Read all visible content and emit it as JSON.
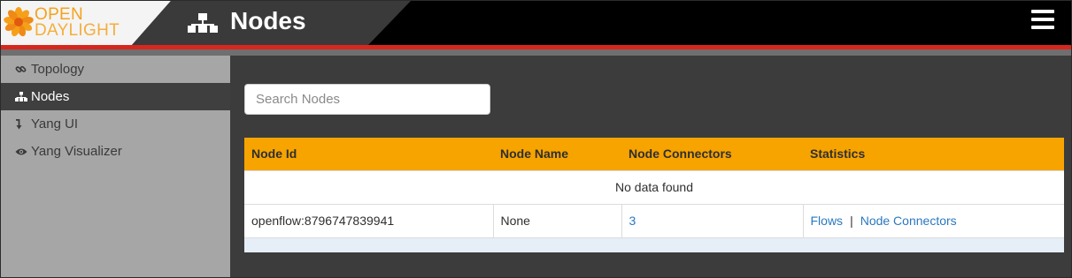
{
  "header": {
    "logo": {
      "line1": "OPEN",
      "line2": "DAYLIGHT"
    },
    "title": "Nodes",
    "colors": {
      "logo": "#f4a21c",
      "accent_stripe": "#d9261c",
      "background": "#000000"
    }
  },
  "sidebar": {
    "items": [
      {
        "label": "Topology",
        "icon": "link-icon",
        "active": false
      },
      {
        "label": "Nodes",
        "icon": "sitemap-icon",
        "active": true
      },
      {
        "label": "Yang UI",
        "icon": "level-down-icon",
        "active": false
      },
      {
        "label": "Yang Visualizer",
        "icon": "eye-icon",
        "active": false
      }
    ]
  },
  "main": {
    "search": {
      "placeholder": "Search Nodes",
      "value": ""
    },
    "table": {
      "columns": [
        "Node Id",
        "Node Name",
        "Node Connectors",
        "Statistics"
      ],
      "header_color": "#f7a400",
      "empty_message": "No data found",
      "rows": [
        {
          "node_id": "openflow:8796747839941",
          "node_name": "None",
          "node_connectors": "3",
          "statistics": {
            "flows_link": "Flows",
            "separator": "|",
            "connectors_link": "Node Connectors"
          }
        }
      ]
    }
  }
}
